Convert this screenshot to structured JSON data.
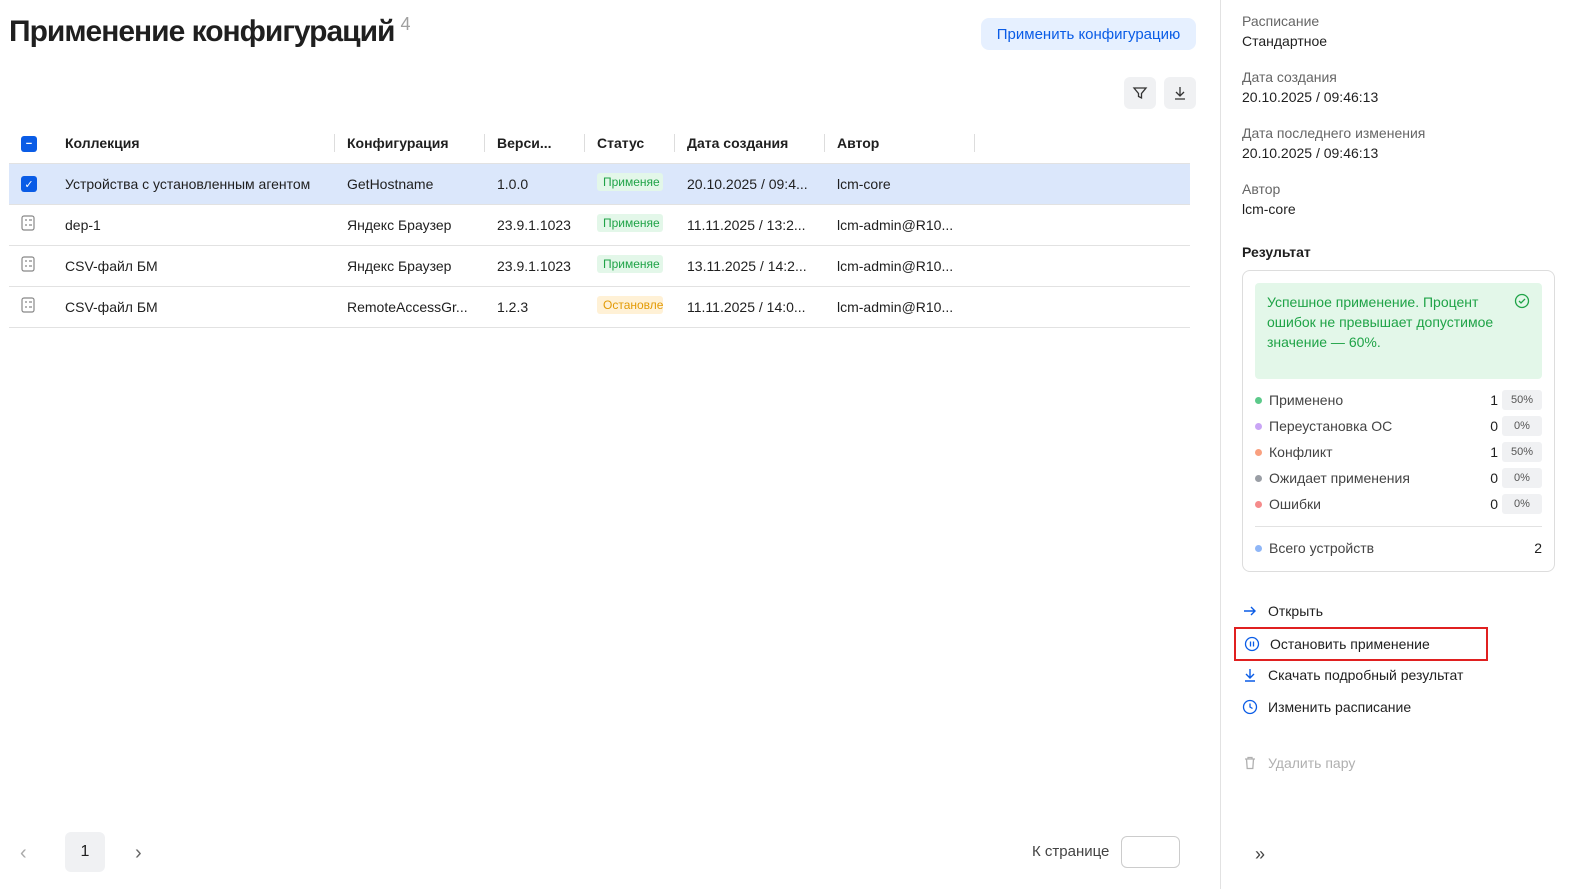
{
  "header": {
    "title": "Применение конфигураций",
    "count": "4",
    "apply_label": "Применить конфигурацию"
  },
  "table": {
    "columns": [
      "Коллекция",
      "Конфигурация",
      "Верси...",
      "Статус",
      "Дата создания",
      "Автор"
    ],
    "rows": [
      {
        "collection": "Устройства с установленным агентом",
        "config": "GetHostname",
        "version": "1.0.0",
        "status": "Применяе",
        "date": "20.10.2025 / 09:4...",
        "author": "lcm-core",
        "selected": true
      },
      {
        "collection": "dep-1",
        "config": "Яндекс Браузер",
        "version": "23.9.1.1023",
        "status": "Применяе",
        "date": "11.11.2025 / 13:2...",
        "author": "lcm-admin@R10...",
        "selected": false
      },
      {
        "collection": "CSV-файл БМ",
        "config": "Яндекс Браузер",
        "version": "23.9.1.1023",
        "status": "Применяе",
        "date": "13.11.2025 / 14:2...",
        "author": "lcm-admin@R10...",
        "selected": false
      },
      {
        "collection": "CSV-файл БМ",
        "config": "RemoteAccessGr...",
        "version": "1.2.3",
        "status": "Остановле",
        "date": "11.11.2025 / 14:0...",
        "author": "lcm-admin@R10...",
        "selected": false
      }
    ]
  },
  "pager": {
    "page": "1",
    "goto_label": "К странице"
  },
  "side": {
    "schedule_label": "Расписание",
    "schedule": "Стандартное",
    "created_label": "Дата создания",
    "created": "20.10.2025 / 09:46:13",
    "modified_label": "Дата последнего изменения",
    "modified": "20.10.2025 / 09:46:13",
    "author_label": "Автор",
    "author": "lcm-core",
    "result_label": "Результат",
    "banner": "Успешное применение. Процент ошибок не превышает допустимое значение — 60%.",
    "stats": [
      {
        "label": "Применено",
        "count": "1",
        "pct": "50%",
        "color": "#5cc98a"
      },
      {
        "label": "Переустановка ОС",
        "count": "0",
        "pct": "0%",
        "color": "#c9a5f5"
      },
      {
        "label": "Конфликт",
        "count": "1",
        "pct": "50%",
        "color": "#f9a07f"
      },
      {
        "label": "Ожидает применения",
        "count": "0",
        "pct": "0%",
        "color": "#9a9ea5"
      },
      {
        "label": "Ошибки",
        "count": "0",
        "pct": "0%",
        "color": "#f58b8b"
      }
    ],
    "total": {
      "label": "Всего устройств",
      "count": "2",
      "color": "#8fb6f7"
    },
    "actions": {
      "open": "Открыть",
      "stop": "Остановить применение",
      "download": "Скачать подробный результат",
      "schedule": "Изменить расписание",
      "delete": "Удалить пару"
    }
  }
}
